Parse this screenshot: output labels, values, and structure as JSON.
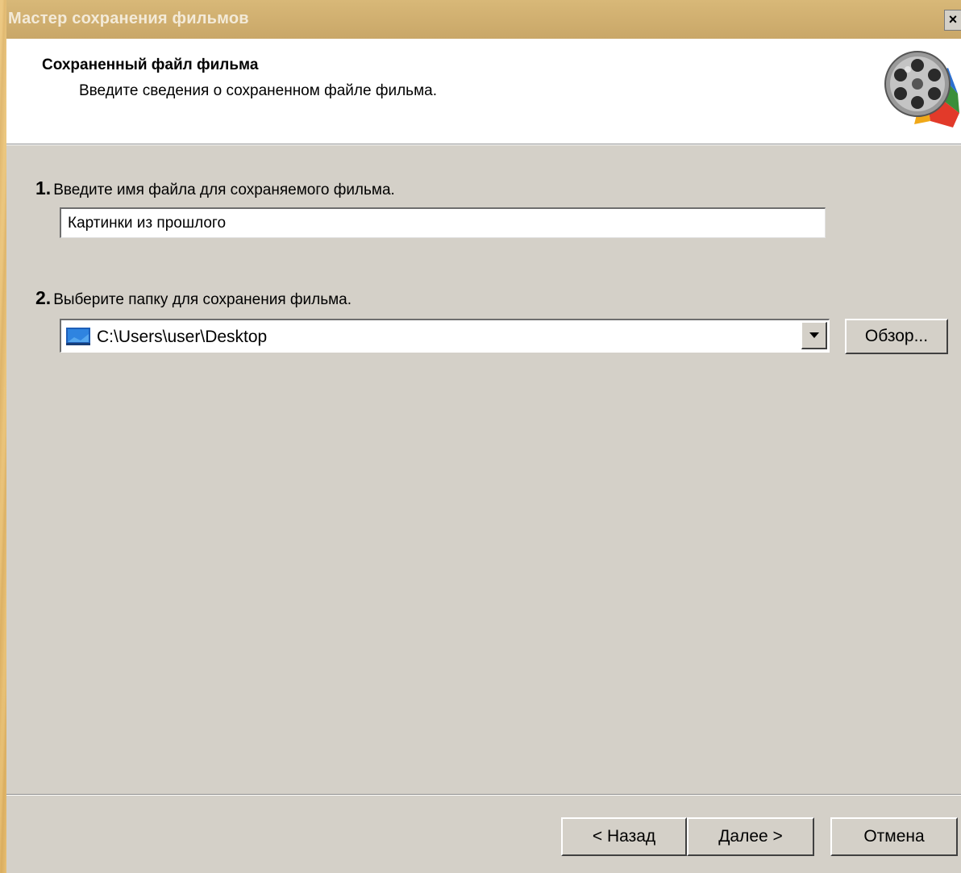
{
  "window": {
    "title": "Мастер сохранения фильмов",
    "close_glyph": "×"
  },
  "header": {
    "title": "Сохраненный файл фильма",
    "subtitle": "Введите сведения о сохраненном файле фильма.",
    "icon": "film-reel-icon"
  },
  "step1": {
    "number": "1.",
    "label": "Введите имя файла для сохраняемого фильма.",
    "value": "Картинки из прошлого"
  },
  "step2": {
    "number": "2.",
    "label": "Выберите папку для сохранения фильма.",
    "folder_icon": "desktop-folder-icon",
    "selected_path": "C:\\Users\\user\\Desktop",
    "browse_label": "Обзор..."
  },
  "footer": {
    "back_label": "< Назад",
    "next_label": "Далее >",
    "cancel_label": "Отмена"
  },
  "colors": {
    "dialog_bg": "#d4d0c8",
    "header_bg": "#ffffff",
    "titlebar_bg": "#cfae6e",
    "desktop_bg": "#e2b865"
  }
}
